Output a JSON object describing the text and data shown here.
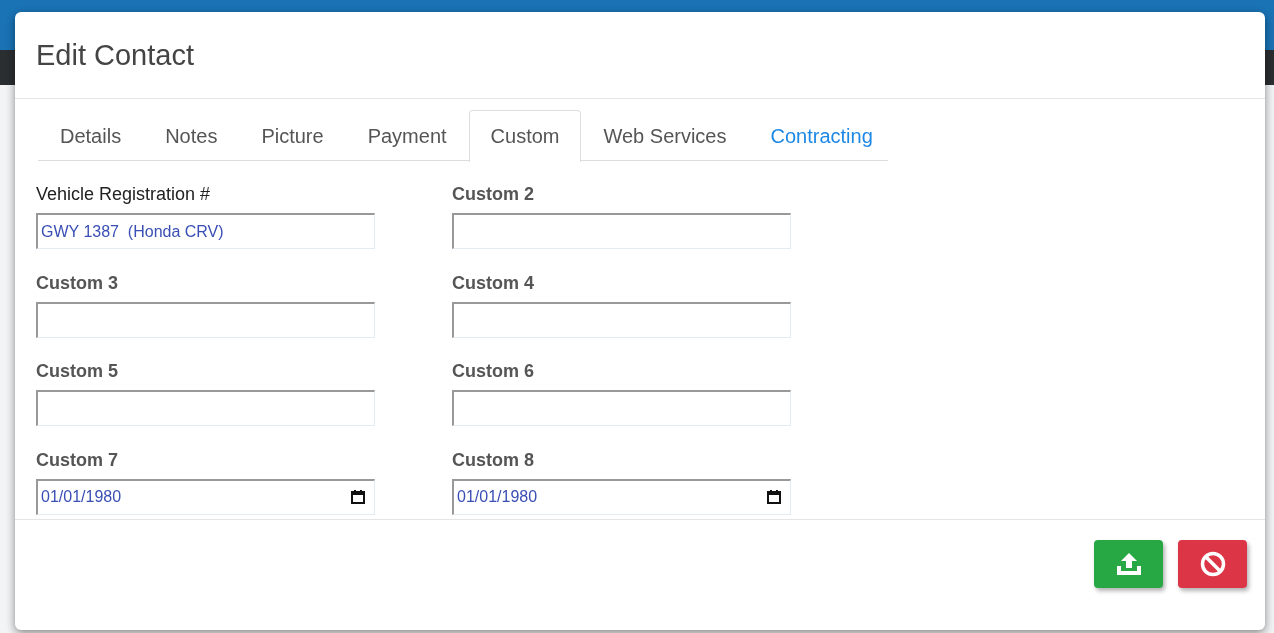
{
  "dialog": {
    "title": "Edit Contact",
    "tabs": [
      {
        "label": "Details",
        "selected": false,
        "accent": false
      },
      {
        "label": "Notes",
        "selected": false,
        "accent": false
      },
      {
        "label": "Picture",
        "selected": false,
        "accent": false
      },
      {
        "label": "Payment",
        "selected": false,
        "accent": false
      },
      {
        "label": "Custom",
        "selected": true,
        "accent": false
      },
      {
        "label": "Web Services",
        "selected": false,
        "accent": false
      },
      {
        "label": "Contracting",
        "selected": false,
        "accent": true
      }
    ],
    "fields": [
      {
        "label": "Vehicle Registration  #",
        "bold": false,
        "kind": "text",
        "value": "GWY 1387  (Honda CRV)"
      },
      {
        "label": "Custom 2",
        "bold": true,
        "kind": "text"
      },
      {
        "label": "Custom 3",
        "bold": true,
        "kind": "text"
      },
      {
        "label": "Custom 4",
        "bold": true,
        "kind": "text"
      },
      {
        "label": "Custom 5",
        "bold": true,
        "kind": "text"
      },
      {
        "label": "Custom 6",
        "bold": true,
        "kind": "text"
      },
      {
        "label": "Custom 7",
        "bold": true,
        "kind": "date",
        "value": "01/01/1980"
      },
      {
        "label": "Custom 8",
        "bold": true,
        "kind": "date",
        "value": "01/01/1980"
      }
    ],
    "buttons": [
      {
        "kind": "save"
      },
      {
        "kind": "cancel"
      }
    ]
  }
}
